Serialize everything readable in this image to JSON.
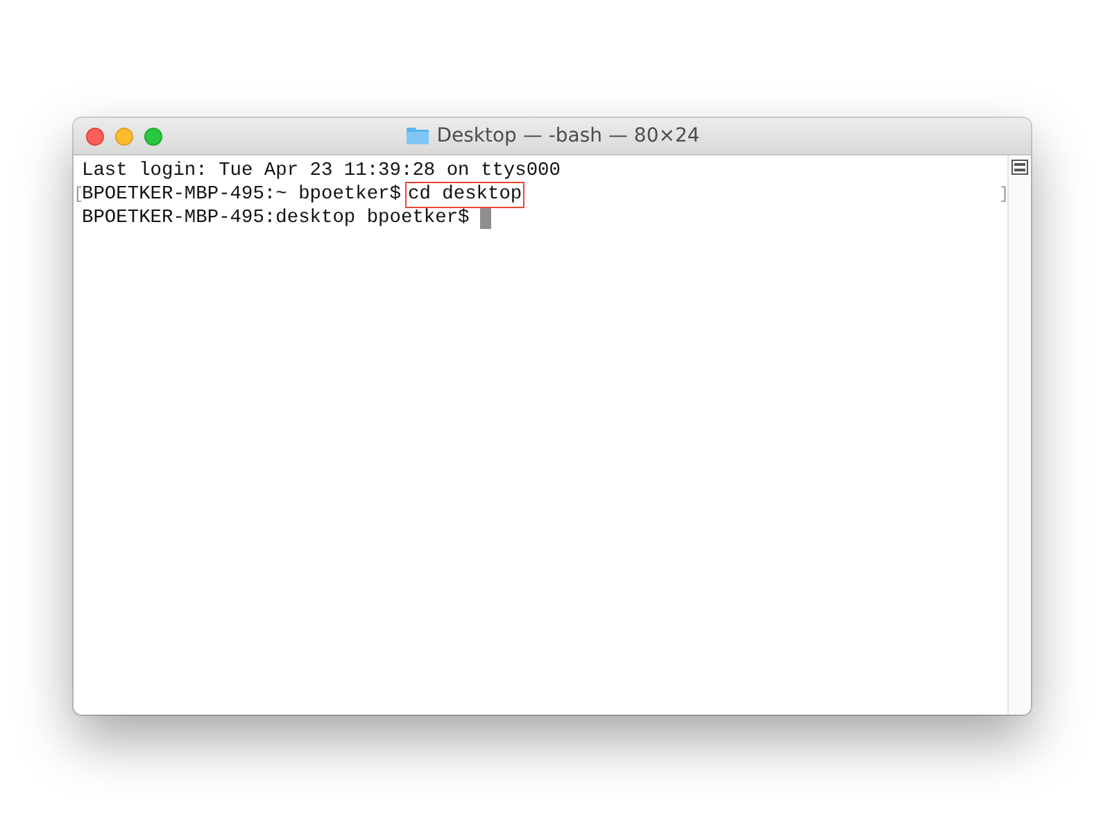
{
  "window": {
    "title": "Desktop — -bash — 80×24"
  },
  "lines": [
    {
      "segments": [
        {
          "text": "Last login: Tue Apr 23 11:39:28 on ttys000",
          "highlighted": false
        }
      ],
      "cursor": false
    },
    {
      "left_mark": "[",
      "right_mark": "]",
      "segments": [
        {
          "text": "BPOETKER-MBP-495:~ bpoetker$",
          "highlighted": false
        },
        {
          "text": "cd desktop",
          "highlighted": true
        }
      ],
      "cursor": false
    },
    {
      "segments": [
        {
          "text": "BPOETKER-MBP-495:desktop bpoetker$",
          "highlighted": false
        }
      ],
      "cursor": true
    }
  ]
}
